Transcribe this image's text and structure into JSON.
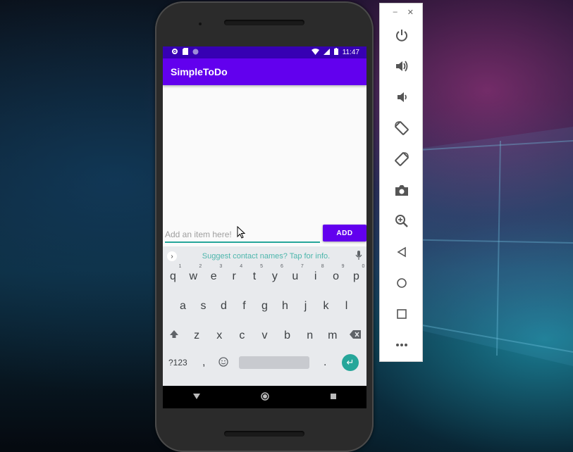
{
  "status_bar": {
    "time": "11:47"
  },
  "app_bar": {
    "title": "SimpleToDo"
  },
  "input": {
    "placeholder": "Add an item here!",
    "value": ""
  },
  "add_button": {
    "label": "ADD"
  },
  "keyboard": {
    "suggestion": "Suggest contact names? Tap for info.",
    "row1": [
      {
        "key": "q",
        "hint": "1"
      },
      {
        "key": "w",
        "hint": "2"
      },
      {
        "key": "e",
        "hint": "3"
      },
      {
        "key": "r",
        "hint": "4"
      },
      {
        "key": "t",
        "hint": "5"
      },
      {
        "key": "y",
        "hint": "6"
      },
      {
        "key": "u",
        "hint": "7"
      },
      {
        "key": "i",
        "hint": "8"
      },
      {
        "key": "o",
        "hint": "9"
      },
      {
        "key": "p",
        "hint": "0"
      }
    ],
    "row2": [
      "a",
      "s",
      "d",
      "f",
      "g",
      "h",
      "j",
      "k",
      "l"
    ],
    "row3": [
      "z",
      "x",
      "c",
      "v",
      "b",
      "n",
      "m"
    ],
    "symbols_label": "?123",
    "comma": ",",
    "period": "."
  },
  "colors": {
    "primary": "#6200ee",
    "primary_dark": "#3700b3",
    "accent": "#26a69a"
  },
  "toolbar": {
    "window_controls": [
      "minimize-icon",
      "close-icon"
    ],
    "buttons": [
      "power-icon",
      "volume-up-icon",
      "volume-down-icon",
      "rotate-left-icon",
      "rotate-right-icon",
      "camera-icon",
      "zoom-icon",
      "back-icon",
      "home-icon",
      "overview-icon",
      "more-icon"
    ]
  }
}
